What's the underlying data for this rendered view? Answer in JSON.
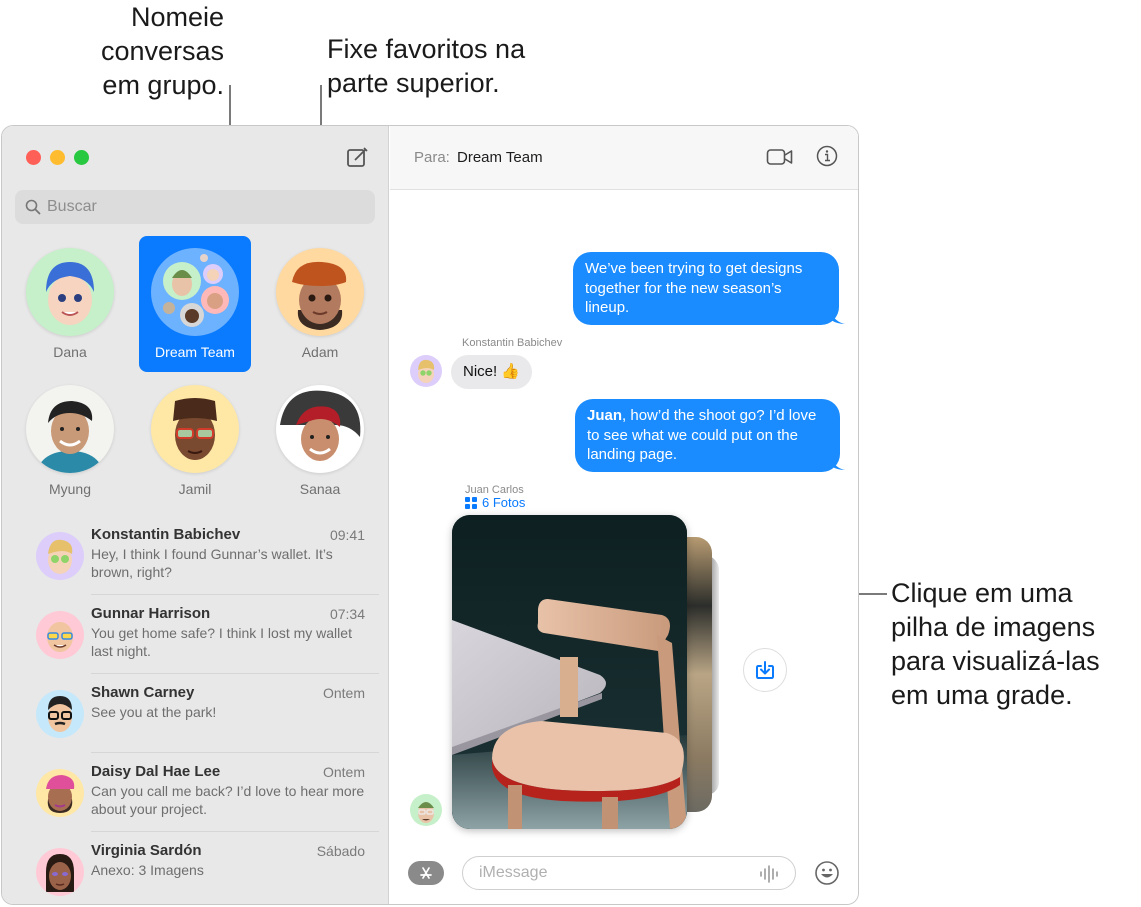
{
  "callouts": {
    "group_names": [
      "Nomeie",
      "conversas",
      "em grupo."
    ],
    "pin_favorites": [
      "Fixe favoritos na",
      "parte superior."
    ],
    "image_stack": [
      "Clique em uma",
      "pilha de imagens",
      "para visualizá-las",
      "em uma grade."
    ]
  },
  "sidebar": {
    "search_placeholder": "Buscar",
    "pinned": [
      {
        "name": "Dana",
        "icon": "memoji-avatar",
        "color": "#c6f0c9",
        "selected": false
      },
      {
        "name": "Dream Team",
        "icon": "group-avatar",
        "color": "#6db2ff",
        "selected": true
      },
      {
        "name": "Adam",
        "icon": "memoji-avatar",
        "color": "#ffd9a0",
        "selected": false
      },
      {
        "name": "Myung",
        "icon": "photo-avatar",
        "color": "#f3f3ef",
        "selected": false
      },
      {
        "name": "Jamil",
        "icon": "memoji-avatar",
        "color": "#ffe8a6",
        "selected": false
      },
      {
        "name": "Sanaa",
        "icon": "photo-avatar",
        "color": "#ffffff",
        "selected": false
      }
    ],
    "conversations": [
      {
        "name": "Konstantin Babichev",
        "time": "09:41",
        "preview": "Hey, I think I found Gunnar’s wallet. It’s brown, right?",
        "color": "#dccdfb"
      },
      {
        "name": "Gunnar Harrison",
        "time": "07:34",
        "preview": "You get home safe? I think I lost my wallet last night.",
        "color": "#ffc9d6"
      },
      {
        "name": "Shawn Carney",
        "time": "Ontem",
        "preview": "See you at the park!",
        "color": "#c6e8fb"
      },
      {
        "name": "Daisy Dal Hae Lee",
        "time": "Ontem",
        "preview": "Can you call me back? I’d love to hear more about your project.",
        "color": "#ffe7a6"
      },
      {
        "name": "Virginia Sardón",
        "time": "Sábado",
        "preview": "Anexo:  3 Imagens",
        "color": "#ffc9d6"
      }
    ]
  },
  "chat": {
    "to_label": "Para:",
    "to_value": "Dream Team",
    "messages": [
      {
        "direction": "out",
        "text": "We’ve been trying to get designs together for the new season’s lineup."
      },
      {
        "direction": "in",
        "sender": "Konstantin Babichev",
        "text": "Nice! 👍"
      },
      {
        "direction": "out",
        "mention": "Juan",
        "text": ", how’d the shoot go? I’d love to see what we could put on the landing page."
      },
      {
        "direction": "in",
        "sender": "Juan Carlos",
        "attachment": "6 Fotos"
      }
    ],
    "composer_placeholder": "iMessage"
  },
  "colors": {
    "accent": "#0a7aff",
    "bubble_out": "#1b8cff",
    "bubble_in": "#e9e9eb",
    "sidebar_bg": "#e8e8e8"
  }
}
